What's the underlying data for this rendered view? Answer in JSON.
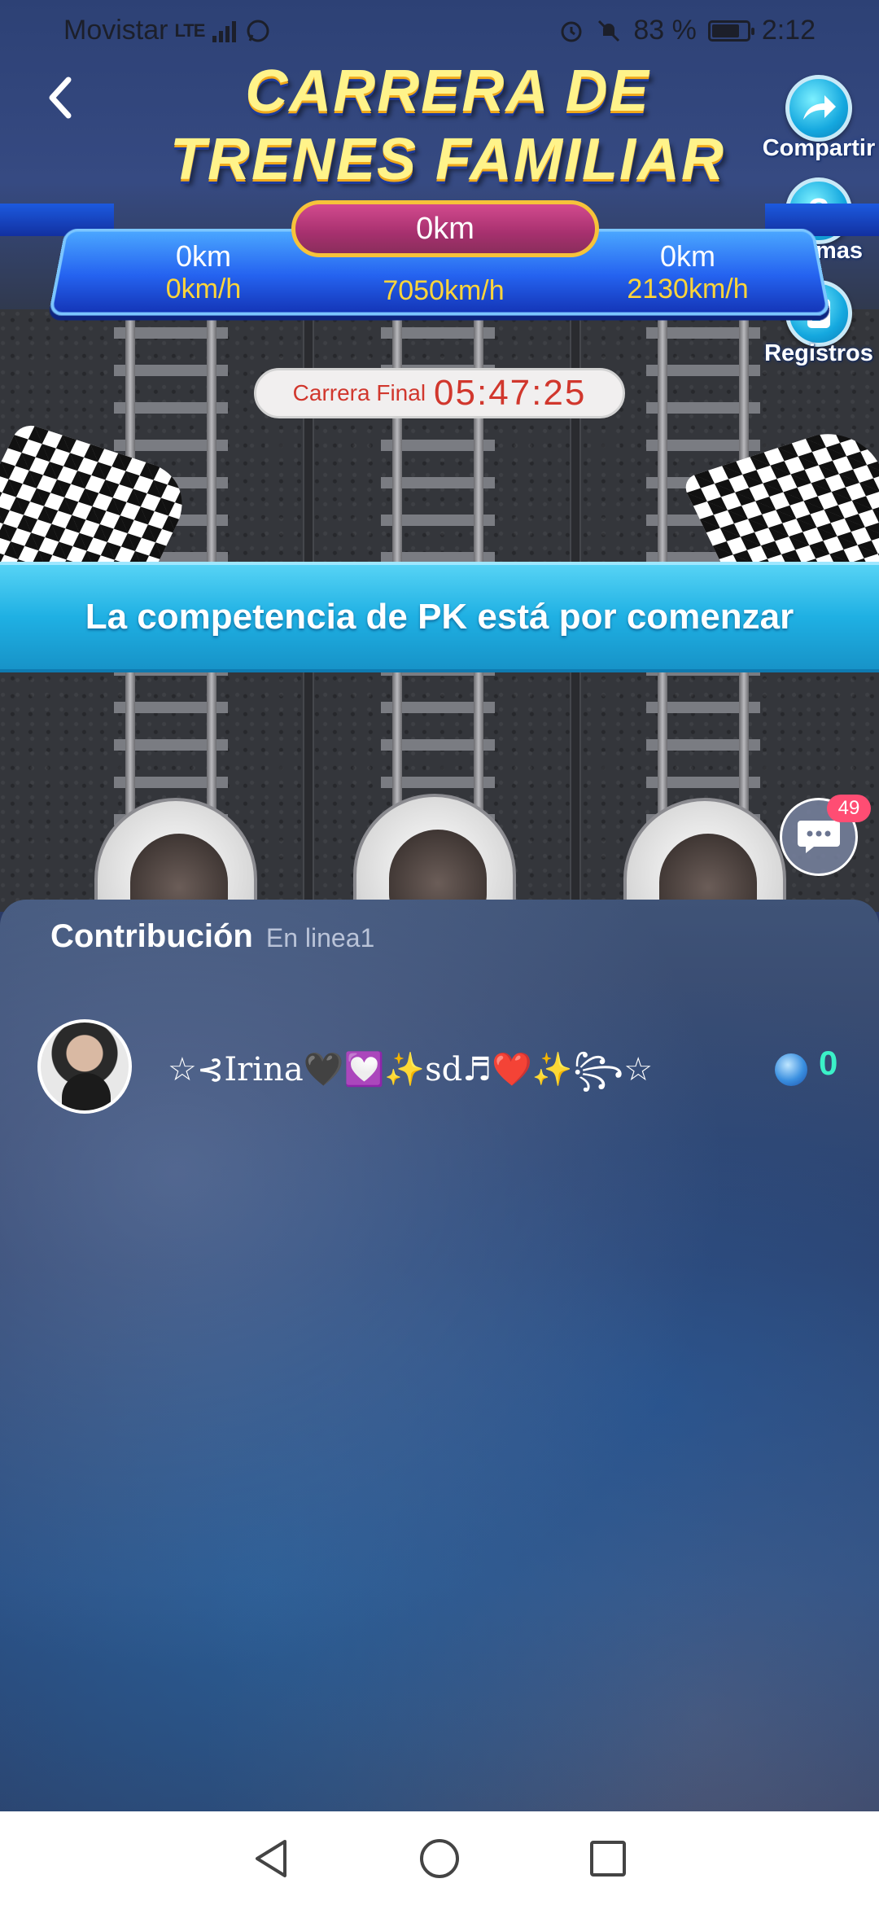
{
  "status_bar": {
    "carrier": "Movistar",
    "network": "LTE",
    "battery": "83 %",
    "battery_level": 0.83,
    "time": "2:12"
  },
  "header": {
    "title_line1": "CARRERA DE",
    "title_line2": "TRENES FAMILIAR"
  },
  "side_actions": {
    "share_label": "Compartir",
    "rules_label": "Normas",
    "records_label": "Registros"
  },
  "race": {
    "center_distance": "0km",
    "center_speed": "7050km/h",
    "left_distance": "0km",
    "left_speed": "0km/h",
    "right_distance": "0km",
    "right_speed": "2130km/h",
    "countdown_label": "Carrera Final",
    "countdown_time": "05:47:25",
    "banner": "La competencia de PK está por comenzar"
  },
  "chat": {
    "badge": "49"
  },
  "contribution": {
    "title": "Contribución",
    "subtitle": "En linea1",
    "rows": [
      {
        "name": "☆⊰Irina🖤💟✨sd♬❤️✨꧂☆",
        "score": "0"
      }
    ]
  },
  "colors": {
    "title_yellow": "#fff38a",
    "speed_yellow": "#ffd53a",
    "banner_blue": "#1fb0e3",
    "score_green": "#3bf1c8",
    "countdown_red": "#d1372d"
  },
  "icons": {
    "back": "chevron-left-icon",
    "share": "share-arrow-icon",
    "rules": "question-icon",
    "records": "document-icon",
    "chat": "chat-bubble-icon",
    "gem": "diamond-icon"
  }
}
